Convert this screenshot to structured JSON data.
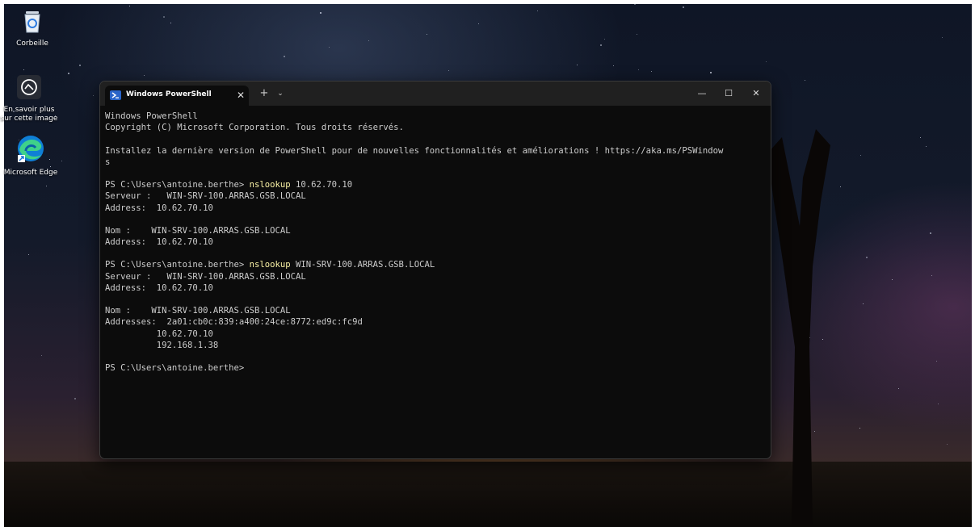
{
  "desktop": {
    "icons": [
      {
        "label": "Corbeille",
        "icon": "recycle-bin-icon"
      },
      {
        "label": "En savoir plus sur cette image",
        "icon": "learn-about-image-icon"
      },
      {
        "label": "Microsoft Edge",
        "icon": "edge-icon"
      }
    ]
  },
  "window": {
    "tab_title": "Windows PowerShell",
    "tab_icon": "powershell-icon",
    "tab_close": "✕",
    "new_tab": "+",
    "dropdown": "⌄",
    "minimize": "—",
    "maximize": "☐",
    "close": "✕"
  },
  "console": {
    "colors": {
      "text": "#cccccc",
      "command": "#f9f1a5",
      "background": "#0c0c0c"
    },
    "lines": [
      {
        "text": "Windows PowerShell"
      },
      {
        "text": "Copyright (C) Microsoft Corporation. Tous droits réservés."
      },
      {
        "text": ""
      },
      {
        "text": "Installez la dernière version de PowerShell pour de nouvelles fonctionnalités et améliorations ! https://aka.ms/PSWindow"
      },
      {
        "text": "s"
      },
      {
        "text": ""
      },
      {
        "prompt": "PS C:\\Users\\antoine.berthe> ",
        "cmd": "nslookup",
        "args": " 10.62.70.10"
      },
      {
        "text": "Serveur :   WIN-SRV-100.ARRAS.GSB.LOCAL"
      },
      {
        "text": "Address:  10.62.70.10"
      },
      {
        "text": ""
      },
      {
        "text": "Nom :    WIN-SRV-100.ARRAS.GSB.LOCAL"
      },
      {
        "text": "Address:  10.62.70.10"
      },
      {
        "text": ""
      },
      {
        "prompt": "PS C:\\Users\\antoine.berthe> ",
        "cmd": "nslookup",
        "args": " WIN-SRV-100.ARRAS.GSB.LOCAL"
      },
      {
        "text": "Serveur :   WIN-SRV-100.ARRAS.GSB.LOCAL"
      },
      {
        "text": "Address:  10.62.70.10"
      },
      {
        "text": ""
      },
      {
        "text": "Nom :    WIN-SRV-100.ARRAS.GSB.LOCAL"
      },
      {
        "text": "Addresses:  2a01:cb0c:839:a400:24ce:8772:ed9c:fc9d"
      },
      {
        "text": "          10.62.70.10"
      },
      {
        "text": "          192.168.1.38"
      },
      {
        "text": ""
      },
      {
        "text": "PS C:\\Users\\antoine.berthe>"
      }
    ]
  }
}
